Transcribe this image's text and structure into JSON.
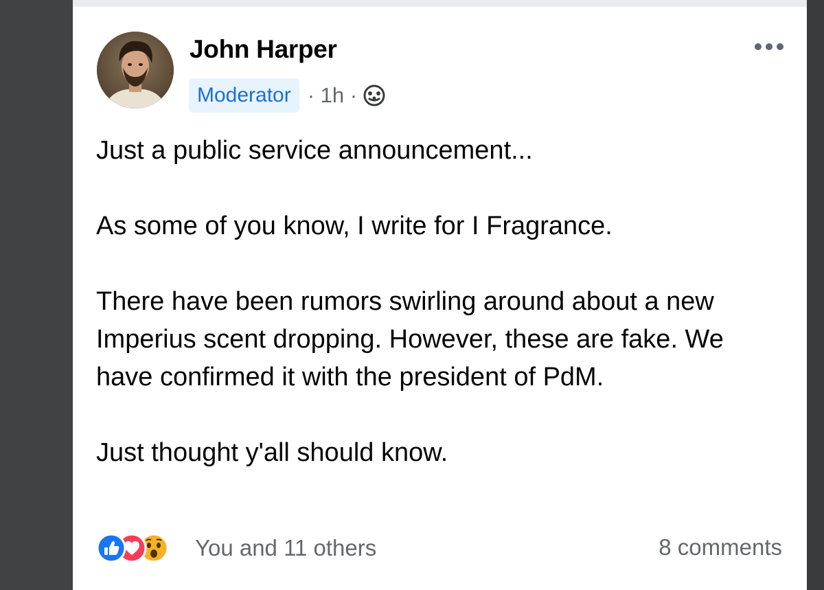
{
  "post": {
    "author": "John Harper",
    "badge": "Moderator",
    "timestamp": "· 1h ·",
    "visibility_icon": "globe-icon",
    "paragraphs": [
      "Just a public service announcement...",
      "As some of you know, I write for I Fragrance.",
      "There have been rumors swirling around about a new Imperius scent dropping. However, these are fake. We have confirmed it with the president of PdM.",
      "Just thought y'all should know."
    ],
    "reactions": {
      "icons": [
        "like-icon",
        "love-icon",
        "wow-icon"
      ],
      "summary": "You and 11 others"
    },
    "comments_label": "8 comments"
  },
  "colors": {
    "badge_bg": "#e7f3ff",
    "badge_text": "#1b6fd1",
    "secondary_text": "#65676b",
    "like_blue": "#1877f2",
    "love_red": "#f33e58",
    "wow_yellow": "#f7b125"
  }
}
